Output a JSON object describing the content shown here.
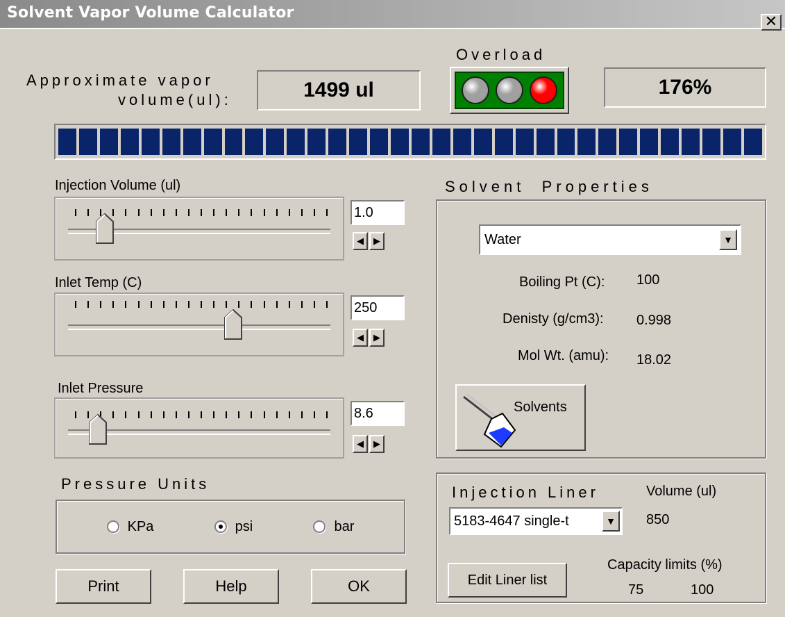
{
  "window": {
    "title": "Solvent Vapor Volume Calculator",
    "close_label": "✕"
  },
  "vapor": {
    "label_line1": "Approximate vapor",
    "label_line2": "volume(ul):",
    "value": "1499 ul"
  },
  "overload": {
    "label": "Overload",
    "percent": "176%",
    "lights": [
      "off",
      "off",
      "on"
    ]
  },
  "progress": {
    "fraction": 1.0,
    "segments": 34
  },
  "injection_volume": {
    "label": "Injection Volume (ul)",
    "value": "1.0",
    "position": 0.12
  },
  "inlet_temp": {
    "label": "Inlet Temp (C)",
    "value": "250",
    "position": 0.63
  },
  "inlet_pressure": {
    "label": "Inlet Pressure",
    "value": "8.6",
    "position": 0.09
  },
  "solvent": {
    "heading": "Solvent  Properties",
    "selected": "Water",
    "boiling_label": "Boiling Pt (C):",
    "boiling_value": "100",
    "density_label": "Denisty (g/cm3):",
    "density_value": "0.998",
    "molwt_label": "Mol Wt. (amu):",
    "molwt_value": "18.02",
    "solvents_button": "Solvents"
  },
  "pressure_units": {
    "heading": "Pressure Units",
    "options": [
      "KPa",
      "psi",
      "bar"
    ],
    "selected": "psi"
  },
  "liner": {
    "heading": "Injection Liner",
    "volume_label": "Volume (ul)",
    "selected": "5183-4647 single-t",
    "volume_value": "850",
    "edit_button": "Edit Liner list",
    "capacity_label": "Capacity limits (%)",
    "capacity_low": "75",
    "capacity_high": "100"
  },
  "buttons": {
    "print": "Print",
    "help": "Help",
    "ok": "OK"
  },
  "colors": {
    "progress_fill": "#0a246a",
    "light_on": "#ff0000",
    "light_off": "#a0a0a0",
    "light_panel": "#008000"
  }
}
